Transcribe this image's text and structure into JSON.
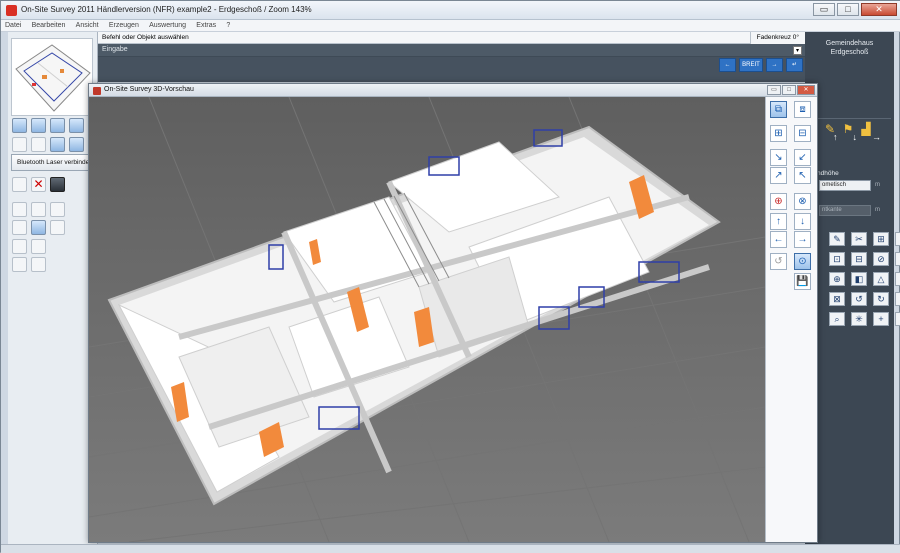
{
  "app": {
    "title": "On-Site Survey 2011 Händlerversion (NFR)  example2 - Erdgeschoß / Zoom 143%",
    "window_buttons": {
      "minimize": "▭",
      "maximize": "□",
      "close": "✕"
    }
  },
  "menu": [
    "Datei",
    "Bearbeiten",
    "Ansicht",
    "Erzeugen",
    "Auswertung",
    "Extras",
    "?"
  ],
  "left_panel": {
    "laser_button": "Bluetooth Laser verbinden"
  },
  "command": {
    "prompt": "Befehl oder Objekt auswählen",
    "crosshair": "Fadenkreuz 0°",
    "input_label": "Eingabe",
    "dropdown": "▾"
  },
  "toolbar_blue": [
    "←",
    "BREIT",
    "→",
    "↵"
  ],
  "right_panel": {
    "building": "Gemeindehaus",
    "floor": "Erdgeschoß",
    "arrows": [
      "↑",
      "↓",
      "→"
    ],
    "height_label": "ndhöhe",
    "height_select": "ometisch",
    "height_unit": "m",
    "edge_label": "ntkante",
    "edge_unit": "m",
    "tools": [
      "✎",
      "✂",
      "⊞",
      "⌖",
      "⊡",
      "⊟",
      "⊘",
      "↕",
      "⊕",
      "◧",
      "△",
      "✕",
      "⊠",
      "↺",
      "↻",
      "⊛",
      "⌕",
      "✳",
      "+",
      "−"
    ]
  },
  "preview": {
    "title": "On-Site Survey 3D-Vorschau",
    "tool_icons": [
      "⧉",
      "⧈",
      "⊞",
      "⊟",
      "↘",
      "↙",
      "↗",
      "↖",
      "⊕",
      "⊗",
      "↑",
      "↓",
      "←",
      "→",
      "↺",
      "⊙",
      "💾"
    ]
  },
  "colors": {
    "viewport_bg": "#6b6b6b",
    "wall": "#e8e8e8",
    "door": "#f28a3c",
    "window": "#2f3fa8"
  }
}
